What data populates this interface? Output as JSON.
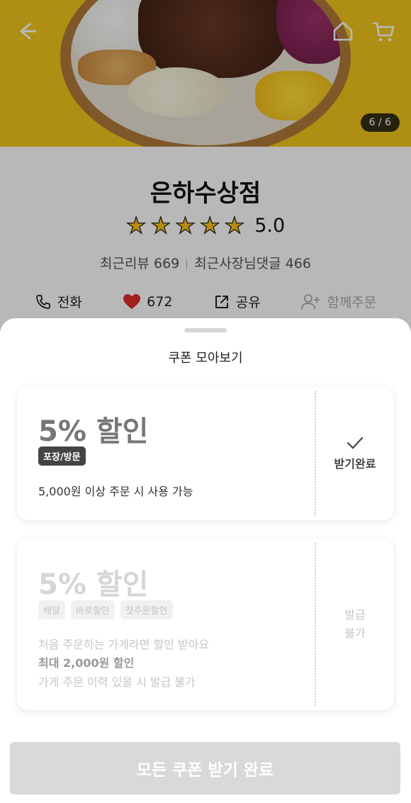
{
  "hero": {
    "pager": "6 / 6",
    "back_icon": "arrow-left-icon",
    "home_icon": "home-icon",
    "cart_icon": "cart-icon"
  },
  "store": {
    "name": "은하수상점",
    "rating": 5.0,
    "rating_text": "5.0",
    "stars_filled": 5,
    "reviews": "최근리뷰 669",
    "owner_replies": "최근사장님댓글 466"
  },
  "actions": {
    "call": "전화",
    "likes": "672",
    "share": "공유",
    "group_order": "함께주문"
  },
  "sheet": {
    "title": "쿠폰 모아보기",
    "coupons": [
      {
        "title": "5% 할인",
        "tags": [
          "포장/방문"
        ],
        "condition": "5,000원 이상 주문 시 사용 가능",
        "status": "받기완료"
      },
      {
        "title": "5% 할인",
        "tags": [
          "배달",
          "바로할인",
          "첫주문할인"
        ],
        "line1": "처음 주문하는 가게라면 할인 받아요",
        "line2": "최대 2,000원 할인",
        "line3": "가게 주문 이력 있을 시 발급 불가",
        "status": "발급 불가"
      }
    ],
    "cta": "모든 쿠폰 받기 완료"
  },
  "colors": {
    "star": "#ffc21a",
    "heart": "#e02c2c",
    "hero_bg": "#f3c51d"
  }
}
